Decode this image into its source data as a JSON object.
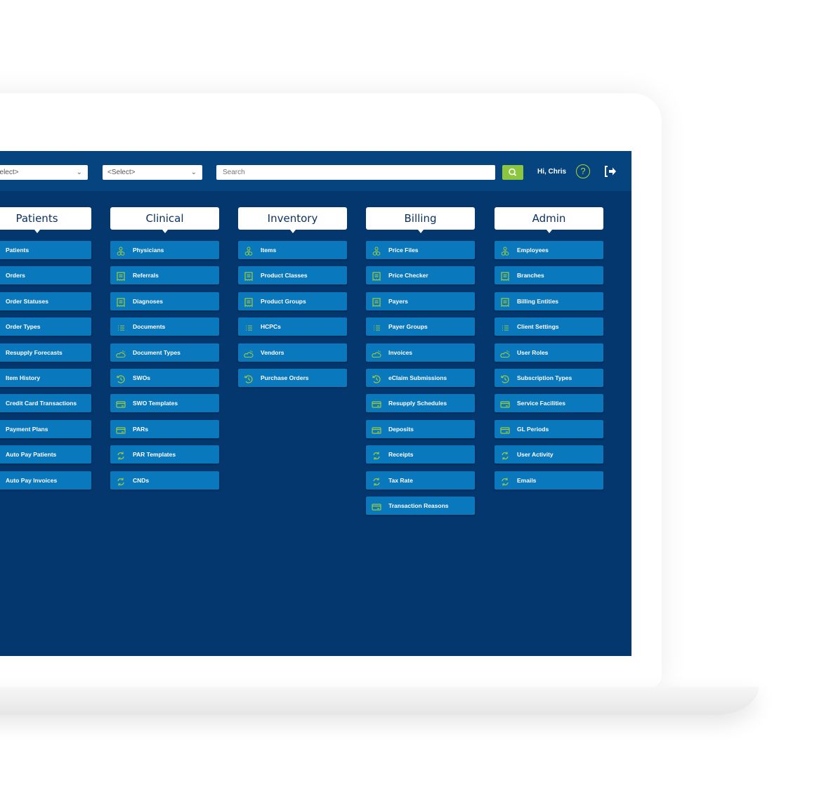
{
  "header": {
    "select1": "<Select>",
    "select2": "<Select>",
    "search_placeholder": "Search",
    "greeting": "Hi, Chris",
    "help": "?"
  },
  "colors": {
    "screen": "#03376d",
    "topbar": "#05447e",
    "button": "#0a78bd",
    "icon": "#9ccb3b",
    "search_button": "#8cc63f"
  },
  "columns": [
    {
      "title": "Patients",
      "items": [
        "Patients",
        "Orders",
        "Order Statuses",
        "Order Types",
        "Resupply Forecasts",
        "Item History",
        "Credit Card Transactions",
        "Payment Plans",
        "Auto Pay Patients",
        "Auto Pay Invoices"
      ]
    },
    {
      "title": "Clinical",
      "items": [
        "Physicians",
        "Referrals",
        "Diagnoses",
        "Documents",
        "Document Types",
        "SWOs",
        "SWO Templates",
        "PARs",
        "PAR Templates",
        "CNDs"
      ]
    },
    {
      "title": "Inventory",
      "items": [
        "Items",
        "Product Classes",
        "Product Groups",
        "HCPCs",
        "Vendors",
        "Purchase Orders"
      ]
    },
    {
      "title": "Billing",
      "items": [
        "Price Files",
        "Price Checker",
        "Payers",
        "Payer Groups",
        "Invoices",
        "eClaim Submissions",
        "Resupply Schedules",
        "Deposits",
        "Receipts",
        "Tax Rate",
        "Transaction Reasons"
      ]
    },
    {
      "title": "Admin",
      "items": [
        "Employees",
        "Branches",
        "Billing Entities",
        "Client Settings",
        "User Roles",
        "Subscription Types",
        "Service Facilities",
        "GL Periods",
        "User Activity",
        "Emails"
      ]
    }
  ],
  "icon_sequence": [
    "person-group-icon",
    "receipt-icon",
    "receipt-icon",
    "list-icon",
    "cloud-sun-icon",
    "history-icon",
    "card-icon",
    "card-icon",
    "refresh-icon",
    "refresh-icon",
    "card-icon"
  ]
}
